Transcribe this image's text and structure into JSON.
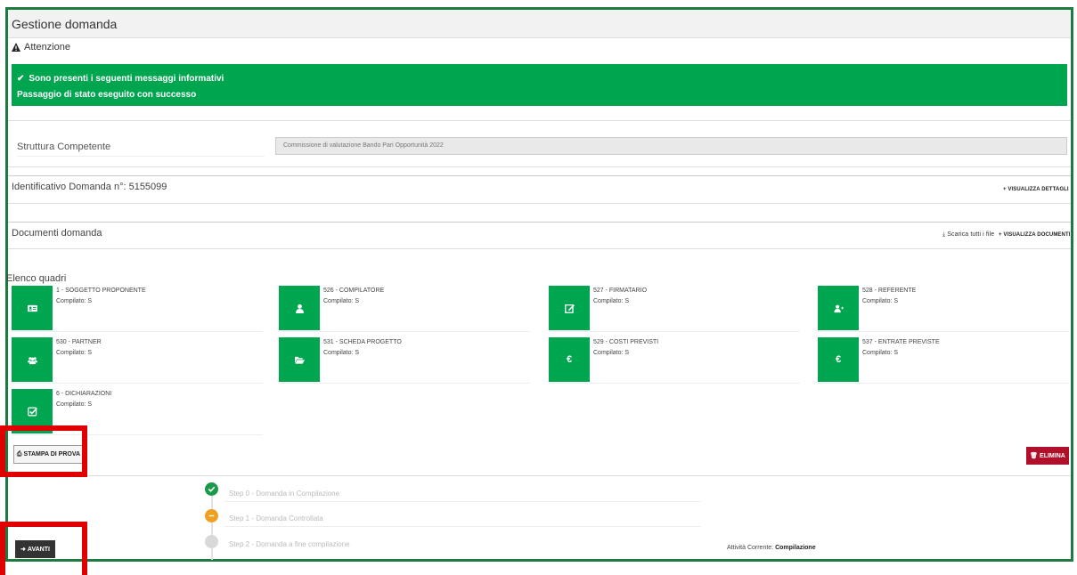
{
  "panel": {
    "title": "Gestione domanda"
  },
  "attention": {
    "label": "Attenzione"
  },
  "alert": {
    "line1": "Sono presenti i seguenti messaggi informativi",
    "line2": "Passaggio di stato eseguito con successo",
    "color": "#00a550"
  },
  "struttura": {
    "label": "Struttura Competente",
    "value": "Commissione di valutazione Bando Pari Opportunità 2022"
  },
  "identificativo": {
    "label": "Identificativo Domanda n°: 5155099",
    "details_link": "VISUALIZZA DETTAGLI"
  },
  "documenti": {
    "label": "Documenti domanda",
    "download_link": "Scarica tutti i file",
    "view_link": "VISUALIZZA DOCUMENTI"
  },
  "quadri": {
    "label": "Elenco quadri",
    "tiles": [
      {
        "title": "1 - SOGGETTO PROPONENTE",
        "status": "Compilato: S",
        "icon": "id-card-icon"
      },
      {
        "title": "526 - COMPILATORE",
        "status": "Compilato: S",
        "icon": "user-icon"
      },
      {
        "title": "527 - FIRMATARIO",
        "status": "Compilato: S",
        "icon": "edit-icon"
      },
      {
        "title": "528 - REFERENTE",
        "status": "Compilato: S",
        "icon": "user-plus-icon"
      },
      {
        "title": "530 - PARTNER",
        "status": "Compilato: S",
        "icon": "users-icon"
      },
      {
        "title": "531 - SCHEDA PROGETTO",
        "status": "Compilato: S",
        "icon": "folder-open-icon"
      },
      {
        "title": "529 - COSTI PREVISTI",
        "status": "Compilato: S",
        "icon": "euro-icon"
      },
      {
        "title": "537 - ENTRATE PREVISTE",
        "status": "Compilato: S",
        "icon": "euro-icon"
      },
      {
        "title": "6 - DICHIARAZIONI",
        "status": "Compilato: S",
        "icon": "check-square-icon"
      }
    ]
  },
  "buttons": {
    "stampa": "STAMPA DI PROVA",
    "elimina": "ELIMINA",
    "avanti": "AVANTI"
  },
  "steps": [
    {
      "label": "Step 0 - Domanda in Compilazione",
      "state": "done",
      "color": "#1a9b4b"
    },
    {
      "label": "Step 1 - Domanda Controllata",
      "state": "current",
      "color": "#f0a020"
    },
    {
      "label": "Step 2 - Domanda a fine compilazione",
      "state": "pending",
      "color": "#d8d8d8"
    }
  ],
  "activity": {
    "label": "Attività Corrente:",
    "value": "Compilazione"
  }
}
